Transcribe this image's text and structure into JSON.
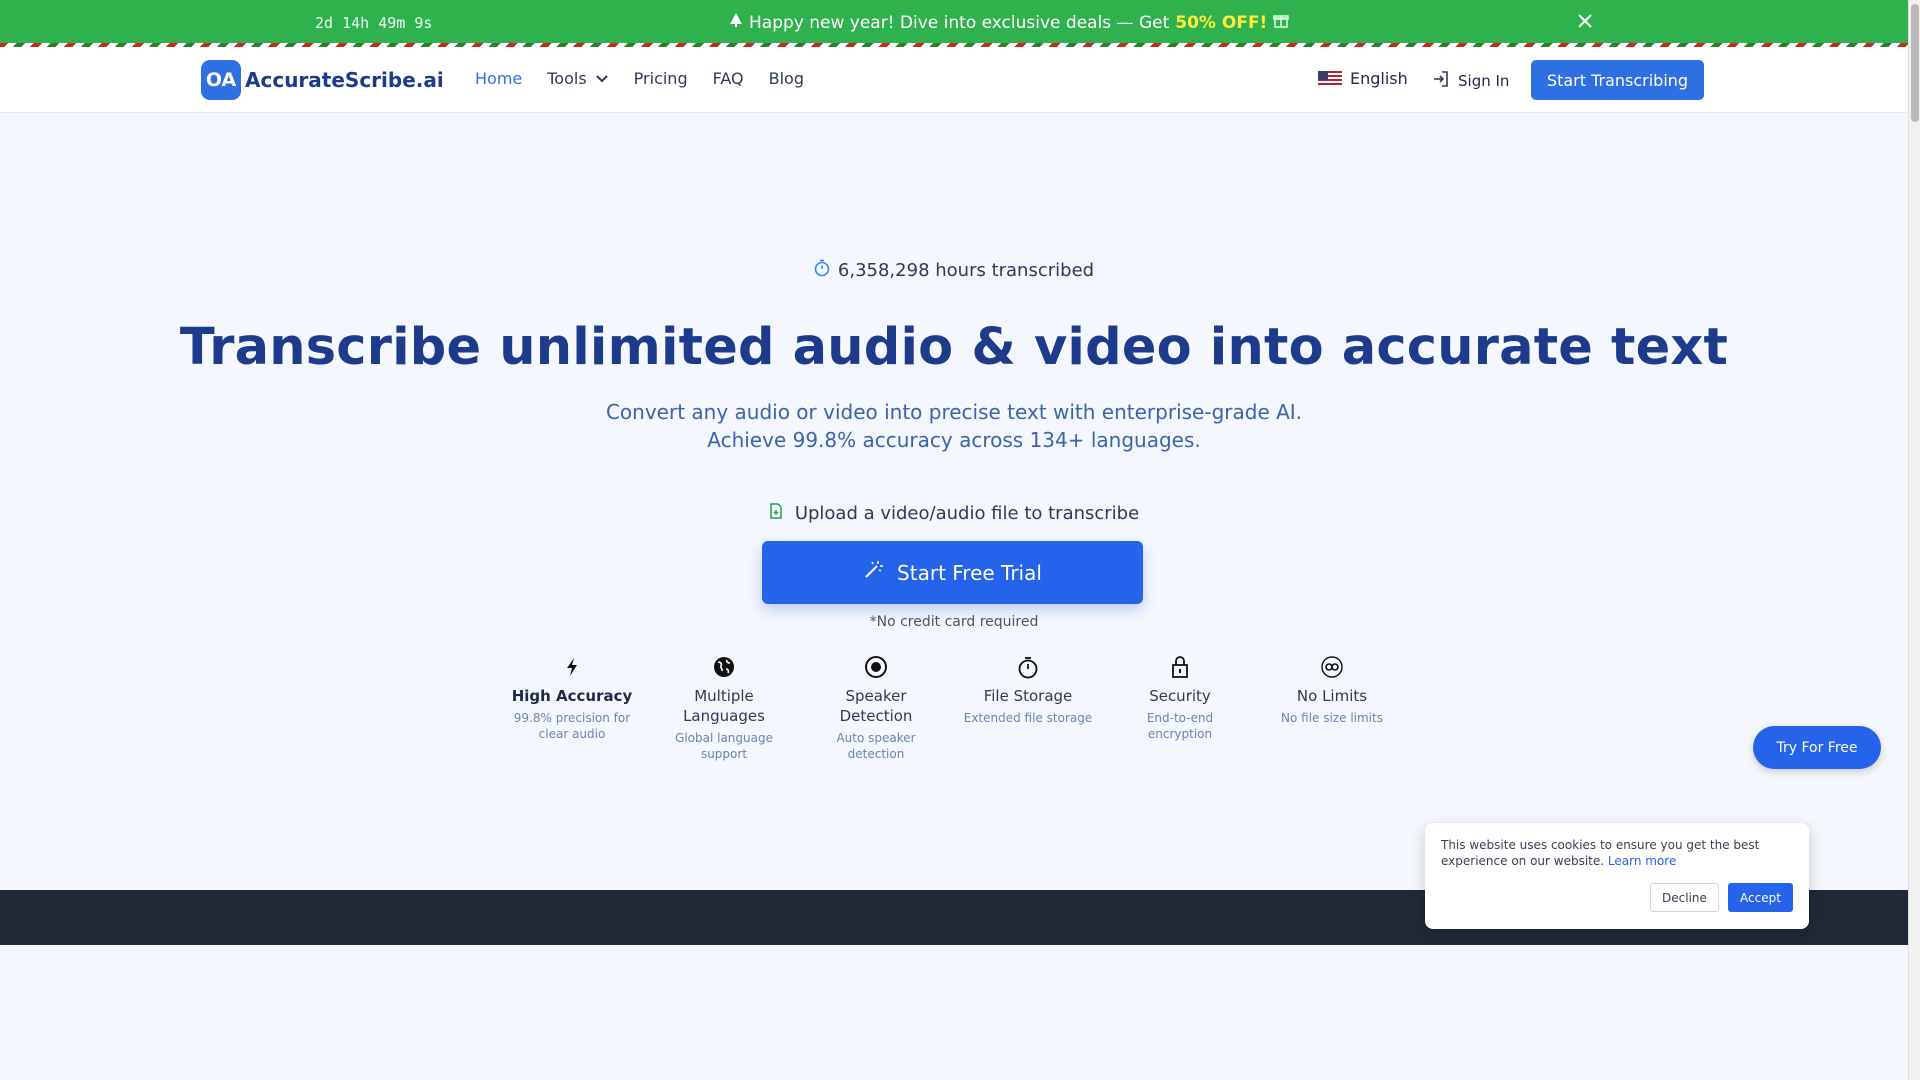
{
  "promo": {
    "timer": "2d 14h 49m 9s",
    "message": "Happy new year! Dive into exclusive deals — Get",
    "deal": "50% OFF!",
    "colors": {
      "background": "#2fb24e",
      "highlight": "#ffeb3b"
    }
  },
  "nav": {
    "logo_mark": "OA",
    "logo_text": "AccurateScribe.ai",
    "links": [
      {
        "label": "Home",
        "active": true
      },
      {
        "label": "Tools",
        "dropdown": true
      },
      {
        "label": "Pricing"
      },
      {
        "label": "FAQ"
      },
      {
        "label": "Blog"
      }
    ],
    "language": "English",
    "sign_in": "Sign In",
    "cta": "Start Transcribing"
  },
  "hero": {
    "stat": "6,358,298 hours transcribed",
    "title": "Transcribe unlimited audio & video into accurate text",
    "subtitle_line1": "Convert any audio or video into precise text with enterprise-grade AI.",
    "subtitle_line2": "Achieve 99.8% accuracy across 134+ languages.",
    "upload_text": "Upload a video/audio file to transcribe",
    "cta": "Start Free Trial",
    "no_card": "*No credit card required"
  },
  "features": [
    {
      "icon": "lightning-icon",
      "title": "High Accuracy",
      "desc": "99.8% precision for clear audio"
    },
    {
      "icon": "globe-icon",
      "title": "Multiple Languages",
      "desc": "Global language support"
    },
    {
      "icon": "target-icon",
      "title": "Speaker Detection",
      "desc": "Auto speaker detection"
    },
    {
      "icon": "stopwatch-icon",
      "title": "File Storage",
      "desc": "Extended file storage"
    },
    {
      "icon": "lock-icon",
      "title": "Security",
      "desc": "End-to-end encryption"
    },
    {
      "icon": "infinity-icon",
      "title": "No Limits",
      "desc": "No file size limits"
    }
  ],
  "floating": {
    "try_free": "Try For Free"
  },
  "cookie": {
    "text": "This website uses cookies to ensure you get the best experience on our website.",
    "learn_more": "Learn more",
    "decline": "Decline",
    "accept": "Accept"
  },
  "colors": {
    "accent": "#2563eb",
    "heading": "#1e3a8a",
    "footer": "#1f2937"
  }
}
